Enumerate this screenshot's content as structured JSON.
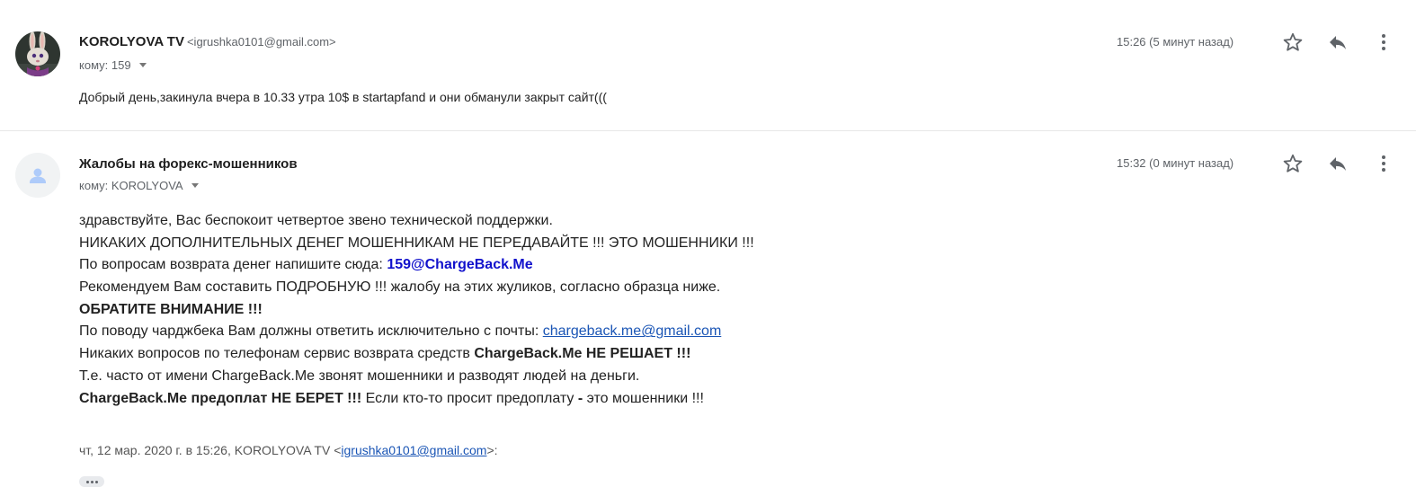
{
  "messages": [
    {
      "sender_name": "KOROLYOVA TV",
      "sender_email": "<igrushka0101@gmail.com>",
      "recipient": "кому: 159",
      "time": "15:26 (5 минут назад)",
      "body": "Добрый день,закинула вчера в 10.33 утра 10$ в startapfand и они обманули закрыт сайт((("
    },
    {
      "sender_name": "Жалобы на форекс-мошенников",
      "recipient": "кому: KOROLYOVA",
      "time": "15:32 (0 минут назад)",
      "lines": {
        "l1": "здравствуйте, Вас беспокоит четвертое звено технической поддержки.",
        "l2": "НИКАКИХ ДОПОЛНИТЕЛЬНЫХ ДЕНЕГ МОШЕННИКАМ НЕ ПЕРЕДАВАЙТЕ !!! ЭТО МОШЕННИКИ !!!",
        "l3_text": "По вопросам возврата денег напишите сюда: ",
        "l3_link": "159@ChargeBack.Me",
        "l4": "Рекомендуем Вам составить ПОДРОБНУЮ !!! жалобу на этих жуликов, согласно образца ниже.",
        "l5": "ОБРАТИТЕ ВНИМАНИЕ !!!",
        "l6_text": "По поводу чарджбека Вам должны ответить исключительно с почты: ",
        "l6_link": "chargeback.me@gmail.com",
        "l7_text": "Никаких вопросов по телефонам сервис возврата средств ",
        "l7_bold": "ChargeBack.Me НЕ РЕШАЕТ !!!",
        "l8": "Т.е. часто от имени ChargeBack.Me звонят мошенники и разводят людей на деньги.",
        "l9_bold": "ChargeBack.Me предоплат НЕ БЕРЕТ !!!",
        "l9_text": " Если кто-то просит предоплату ",
        "l9_dash": "-",
        "l9_end": " это мошенники !!!"
      },
      "quote": {
        "prefix": "чт, 12 мар. 2020 г. в 15:26, KOROLYOVA TV <",
        "email": "igrushka0101@gmail.com",
        "suffix": ">:"
      }
    }
  ],
  "icons": {
    "star": "star-icon",
    "reply": "reply-icon",
    "more": "more-vert-icon",
    "avatar_default": "person-icon"
  },
  "colors": {
    "link": "#1a55b5",
    "support_link": "#1111cc",
    "secondary_text": "#5f6368"
  }
}
